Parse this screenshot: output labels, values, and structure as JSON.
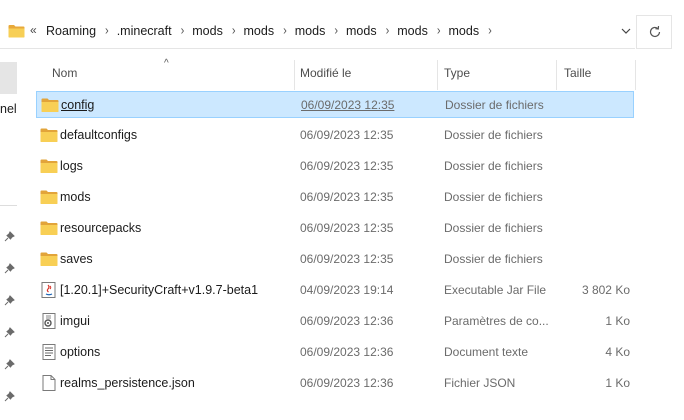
{
  "address": {
    "overflow_glyph": "«",
    "crumbs": [
      "Roaming",
      ".minecraft",
      "mods",
      "mods",
      "mods",
      "mods",
      "mods",
      "mods"
    ],
    "separator": "›"
  },
  "left_pane": {
    "partial_label": "nel"
  },
  "columns": {
    "name": "Nom",
    "modified": "Modifié le",
    "type": "Type",
    "size": "Taille",
    "sort_indicator": "^"
  },
  "files": [
    {
      "name": "config",
      "modified": "06/09/2023 12:35",
      "type": "Dossier de fichiers",
      "size": "",
      "icon": "folder-icon",
      "selected": true
    },
    {
      "name": "defaultconfigs",
      "modified": "06/09/2023 12:35",
      "type": "Dossier de fichiers",
      "size": "",
      "icon": "folder-icon"
    },
    {
      "name": "logs",
      "modified": "06/09/2023 12:35",
      "type": "Dossier de fichiers",
      "size": "",
      "icon": "folder-icon"
    },
    {
      "name": "mods",
      "modified": "06/09/2023 12:35",
      "type": "Dossier de fichiers",
      "size": "",
      "icon": "folder-icon"
    },
    {
      "name": "resourcepacks",
      "modified": "06/09/2023 12:35",
      "type": "Dossier de fichiers",
      "size": "",
      "icon": "folder-icon"
    },
    {
      "name": "saves",
      "modified": "06/09/2023 12:35",
      "type": "Dossier de fichiers",
      "size": "",
      "icon": "folder-icon"
    },
    {
      "name": "[1.20.1]+SecurityCraft+v1.9.7-beta1",
      "modified": "04/09/2023 19:14",
      "type": "Executable Jar File",
      "size": "3 802 Ko",
      "icon": "java-jar-icon"
    },
    {
      "name": "imgui",
      "modified": "06/09/2023 12:36",
      "type": "Paramètres de co...",
      "size": "1 Ko",
      "icon": "settings-file-icon"
    },
    {
      "name": "options",
      "modified": "06/09/2023 12:36",
      "type": "Document texte",
      "size": "4 Ko",
      "icon": "text-file-icon"
    },
    {
      "name": "realms_persistence.json",
      "modified": "06/09/2023 12:36",
      "type": "Fichier JSON",
      "size": "1 Ko",
      "icon": "json-file-icon"
    }
  ],
  "colors": {
    "selection_bg": "#cce8ff",
    "selection_border": "#99d1ff",
    "folder": "#f3c74a"
  }
}
